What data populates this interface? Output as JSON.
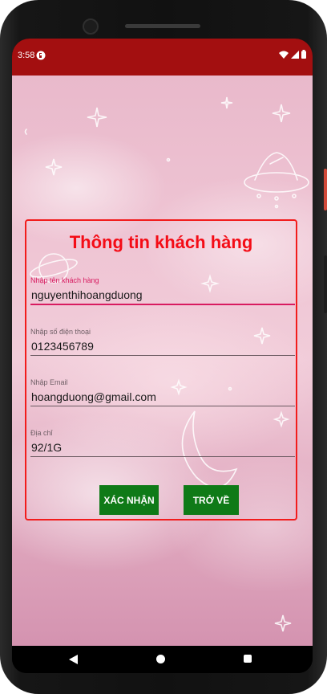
{
  "status_bar": {
    "time": "3:58",
    "icons": [
      "app-notification-icon",
      "wifi-icon",
      "signal-icon",
      "battery-icon"
    ],
    "background_color": "#a30f10"
  },
  "form": {
    "title": "Thông tin khách hàng",
    "title_color": "#f40c16",
    "border_color": "#f21c1c",
    "fields": [
      {
        "label": "Nhập tên khách hàng",
        "value": "nguyenthihoangduong",
        "focused": true
      },
      {
        "label": "Nhập số điện thoại",
        "value": "0123456789",
        "focused": false
      },
      {
        "label": "Nhập Email",
        "value": "hoangduong@gmail.com",
        "focused": false
      },
      {
        "label": "Địa chỉ",
        "value": "92/1G",
        "focused": false
      }
    ],
    "buttons": {
      "confirm_label": "XÁC NHẬN",
      "back_label": "TRỞ VỀ",
      "color": "#0f7a17"
    }
  },
  "nav_bar": {
    "icons": [
      "back-icon",
      "home-icon",
      "recents-icon"
    ]
  }
}
